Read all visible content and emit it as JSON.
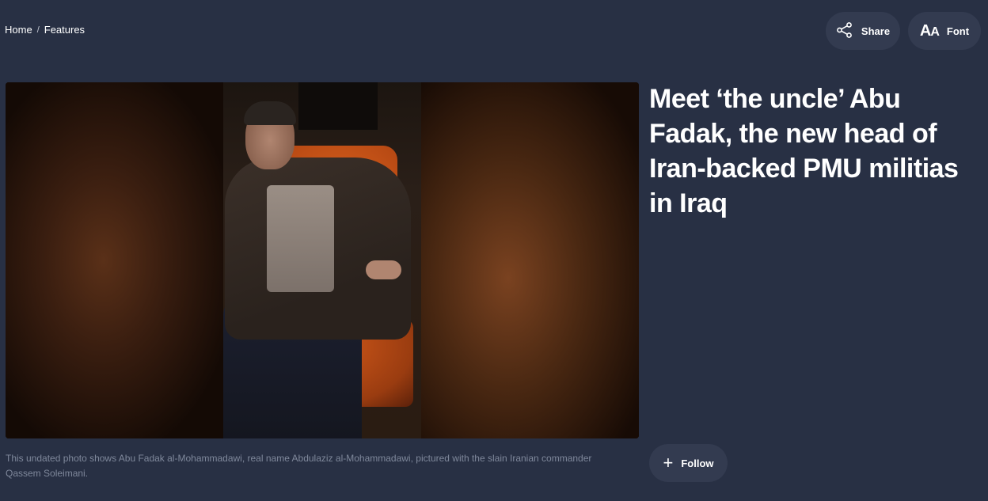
{
  "breadcrumb": {
    "items": [
      "Home",
      "Features"
    ],
    "separator": "/"
  },
  "toolbar": {
    "share_label": "Share",
    "font_label": "Font",
    "font_icon_big": "A",
    "font_icon_small": "A"
  },
  "article": {
    "headline": "Meet ‘the uncle’ Abu Fadak, the new head of Iran-backed PMU militias in Iraq",
    "image_caption": "This undated photo shows Abu Fadak al-Mohammadawi, real name Abdulaziz al-Mohammadawi, pictured with the slain Iranian commander Qassem Soleimani.",
    "follow_label": "Follow",
    "follow_icon": "+"
  },
  "icons": {
    "share": "share-icon",
    "font": "font-size-icon",
    "follow": "plus-icon"
  },
  "colors": {
    "background": "#283044",
    "button_bg": "#333b50",
    "caption_text": "#7f889b",
    "text": "#ffffff"
  }
}
